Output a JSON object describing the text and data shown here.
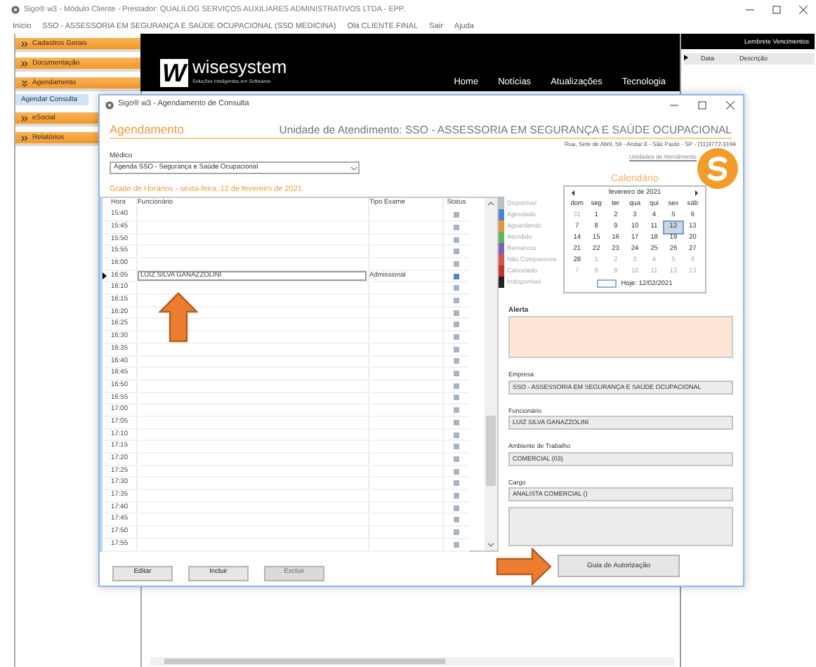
{
  "window": {
    "title": "Sigo® w3 - Módulo Cliente - Prestador: QUALILOG SERVIÇOS AUXILIARES ADMINISTRATIVOS LTDA - EPP."
  },
  "menu": [
    "Início",
    "SSO - ASSESSORIA EM SEGURANÇA E SAÚDE OCUPACIONAL (SSO MEDICINA)",
    "Olá CLIENTE FINAL",
    "Sair",
    "Ajuda"
  ],
  "sidebar": {
    "items": [
      {
        "label": "Cadastros Gerais",
        "expanded": false
      },
      {
        "label": "Documentação",
        "expanded": false
      },
      {
        "label": "Agendamento",
        "expanded": true,
        "children": [
          {
            "label": "Agendar Consulta",
            "selected": true
          }
        ]
      },
      {
        "label": "eSocial",
        "expanded": false
      },
      {
        "label": "Relatórios",
        "expanded": false
      }
    ]
  },
  "banner": {
    "logo_mark": "W",
    "logo": "wisesystem",
    "tagline": "Soluções Inteligentes em Softwares",
    "nav": [
      "Home",
      "Notícias",
      "Atualizações",
      "Tecnologia"
    ]
  },
  "reminders": {
    "title": "Lembrete Vencimentos",
    "columns": [
      "Data",
      "Descrição"
    ]
  },
  "dialog": {
    "title": "Sigo® w3 - Agendamento de Consulta",
    "heading": "Agendamento",
    "unit": "Unidade de Atendimento: SSO - ASSESSORIA EM SEGURANÇA E SAÚDE OCUPACIONAL",
    "address": "Rua, Sete de Abril, 59 - Andar 8 - São Paulo - SP - (11)3772-3194",
    "units_link": "Unidades de Atendimento",
    "doctor_label": "Médico",
    "doctor": "Agenda SSO - Segurança e Saúde Ocupacional",
    "grid_title": "Grade de Horários - sexta-feira, 12 de fevereiro de 2021",
    "grid": {
      "columns": [
        "Hora",
        "Funcionário",
        "Tipo Exame",
        "Status"
      ],
      "rows": [
        {
          "time": "15:40",
          "selected": false,
          "color": "#a9b4c2"
        },
        {
          "time": "15:45",
          "selected": false,
          "color": "#a9b4c2"
        },
        {
          "time": "15:50",
          "selected": false,
          "color": "#a9b4c2"
        },
        {
          "time": "15:55",
          "selected": false,
          "color": "#a9b4c2"
        },
        {
          "time": "16:00",
          "selected": false,
          "color": "#a9b4c2"
        },
        {
          "time": "16:05",
          "employee": "LUIZ SILVA GANAZZOLINI",
          "exam": "Admissional",
          "selected": true,
          "color": "#4f86c6"
        },
        {
          "time": "16:10",
          "selected": false,
          "color": "#a9b4c2"
        },
        {
          "time": "16:15",
          "selected": false,
          "color": "#a9b4c2"
        },
        {
          "time": "16:20",
          "selected": false,
          "color": "#a9b4c2"
        },
        {
          "time": "16:25",
          "selected": false,
          "color": "#a9b4c2"
        },
        {
          "time": "16:30",
          "selected": false,
          "color": "#a9b4c2"
        },
        {
          "time": "16:35",
          "selected": false,
          "color": "#a9b4c2"
        },
        {
          "time": "16:40",
          "selected": false,
          "color": "#a9b4c2"
        },
        {
          "time": "16:45",
          "selected": false,
          "color": "#a9b4c2"
        },
        {
          "time": "16:50",
          "selected": false,
          "color": "#a9b4c2"
        },
        {
          "time": "16:55",
          "selected": false,
          "color": "#a9b4c2"
        },
        {
          "time": "17:00",
          "selected": false,
          "color": "#a9b4c2"
        },
        {
          "time": "17:05",
          "selected": false,
          "color": "#a9b4c2"
        },
        {
          "time": "17:10",
          "selected": false,
          "color": "#a9b4c2"
        },
        {
          "time": "17:15",
          "selected": false,
          "color": "#a9b4c2"
        },
        {
          "time": "17:20",
          "selected": false,
          "color": "#a9b4c2"
        },
        {
          "time": "17:25",
          "selected": false,
          "color": "#a9b4c2"
        },
        {
          "time": "17:30",
          "selected": false,
          "color": "#a9b4c2"
        },
        {
          "time": "17:35",
          "selected": false,
          "color": "#a9b4c2"
        },
        {
          "time": "17:40",
          "selected": false,
          "color": "#a9b4c2"
        },
        {
          "time": "17:45",
          "selected": false,
          "color": "#a9b4c2"
        },
        {
          "time": "17:50",
          "selected": false,
          "color": "#a9b4c2"
        },
        {
          "time": "17:55",
          "selected": false,
          "color": "#a9b4c2"
        }
      ]
    },
    "calendar_title": "Calendário",
    "legend": [
      {
        "label": "Disponível",
        "color": "#b8c0cc"
      },
      {
        "label": "Agendado",
        "color": "#4f86c6"
      },
      {
        "label": "Aguardando",
        "color": "#f0913a"
      },
      {
        "label": "Atendido",
        "color": "#5cb85c"
      },
      {
        "label": "Remarcou",
        "color": "#7b62b8"
      },
      {
        "label": "Não Compareceu",
        "color": "#d9534f"
      },
      {
        "label": "Cancelado",
        "color": "#c9302c"
      },
      {
        "label": "Indisponível",
        "color": "#222222"
      }
    ],
    "calendar": {
      "month": "fevereiro de 2021",
      "weekdays": [
        "dom",
        "seg",
        "ter",
        "qua",
        "qui",
        "sex",
        "sáb"
      ],
      "weeks": [
        {
          "days": [
            {
              "day": "31",
              "muted": true,
              "selected": false
            },
            {
              "day": "1",
              "muted": false,
              "selected": false
            },
            {
              "day": "2",
              "muted": false,
              "selected": false
            },
            {
              "day": "3",
              "muted": false,
              "selected": false
            },
            {
              "day": "4",
              "muted": false,
              "selected": false
            },
            {
              "day": "5",
              "muted": false,
              "selected": false
            },
            {
              "day": "6",
              "muted": false,
              "selected": false
            }
          ]
        },
        {
          "days": [
            {
              "day": "7",
              "muted": false,
              "selected": false
            },
            {
              "day": "8",
              "muted": false,
              "selected": false
            },
            {
              "day": "9",
              "muted": false,
              "selected": false
            },
            {
              "day": "10",
              "muted": false,
              "selected": false
            },
            {
              "day": "11",
              "muted": false,
              "selected": false
            },
            {
              "day": "12",
              "muted": false,
              "selected": true
            },
            {
              "day": "13",
              "muted": false,
              "selected": false
            }
          ]
        },
        {
          "days": [
            {
              "day": "14",
              "muted": false,
              "selected": false
            },
            {
              "day": "15",
              "muted": false,
              "selected": false
            },
            {
              "day": "16",
              "muted": false,
              "selected": false
            },
            {
              "day": "17",
              "muted": false,
              "selected": false
            },
            {
              "day": "18",
              "muted": false,
              "selected": false
            },
            {
              "day": "19",
              "muted": false,
              "selected": false
            },
            {
              "day": "20",
              "muted": false,
              "selected": false
            }
          ]
        },
        {
          "days": [
            {
              "day": "21",
              "muted": false,
              "selected": false
            },
            {
              "day": "22",
              "muted": false,
              "selected": false
            },
            {
              "day": "23",
              "muted": false,
              "selected": false
            },
            {
              "day": "24",
              "muted": false,
              "selected": false
            },
            {
              "day": "25",
              "muted": false,
              "selected": false
            },
            {
              "day": "26",
              "muted": false,
              "selected": false
            },
            {
              "day": "27",
              "muted": false,
              "selected": false
            }
          ]
        },
        {
          "days": [
            {
              "day": "28",
              "muted": false,
              "selected": false
            },
            {
              "day": "1",
              "muted": true,
              "selected": false
            },
            {
              "day": "2",
              "muted": true,
              "selected": false
            },
            {
              "day": "3",
              "muted": true,
              "selected": false
            },
            {
              "day": "4",
              "muted": true,
              "selected": false
            },
            {
              "day": "5",
              "muted": true,
              "selected": false
            },
            {
              "day": "6",
              "muted": true,
              "selected": false
            }
          ]
        },
        {
          "days": [
            {
              "day": "7",
              "muted": true,
              "selected": false
            },
            {
              "day": "8",
              "muted": true,
              "selected": false
            },
            {
              "day": "9",
              "muted": true,
              "selected": false
            },
            {
              "day": "10",
              "muted": true,
              "selected": false
            },
            {
              "day": "11",
              "muted": true,
              "selected": false
            },
            {
              "day": "12",
              "muted": true,
              "selected": false
            },
            {
              "day": "13",
              "muted": true,
              "selected": false
            }
          ]
        }
      ],
      "today": "Hoje: 12/02/2021"
    },
    "alert_label": "Alerta",
    "fields": [
      {
        "label": "Empresa",
        "value": "SSO - ASSESSORIA EM SEGURANÇA E SAÚDE OCUPACIONAL"
      },
      {
        "label": "Funcionário",
        "value": "LUIZ SILVA GANAZZOLINI"
      },
      {
        "label": "Ambiente de Trabalho",
        "value": "COMERCIAL (03)"
      },
      {
        "label": "Cargo",
        "value": "ANALISTA COMERCIAL ()"
      }
    ],
    "buttons": [
      {
        "label": "Editar",
        "disabled": false
      },
      {
        "label": "Incluir",
        "disabled": false
      },
      {
        "label": "Excluir",
        "disabled": true
      }
    ],
    "auth_button": "Guia de Autorização"
  }
}
